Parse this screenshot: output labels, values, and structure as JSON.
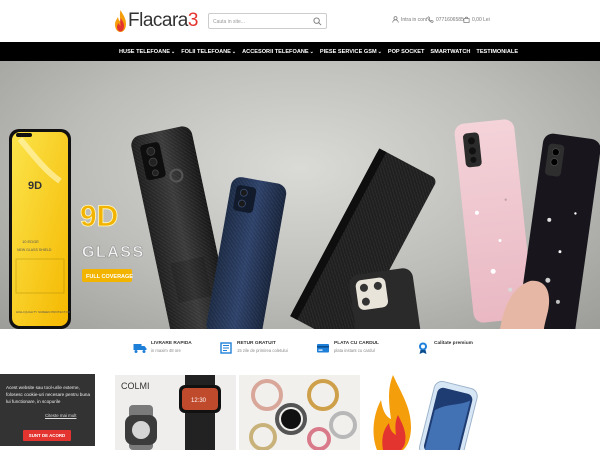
{
  "header": {
    "logo_text": "Flacara",
    "logo_number": "3",
    "search_placeholder": "Cauta in site...",
    "login_label": "Intra in cont",
    "phone": "0771606585",
    "cart_total": "0,00 Lei"
  },
  "nav": {
    "items": [
      {
        "label": "HUSE TELEFOANE",
        "dropdown": true
      },
      {
        "label": "FOLII TELEFOANE",
        "dropdown": true
      },
      {
        "label": "ACCESORII TELEFOANE",
        "dropdown": true
      },
      {
        "label": "PIESE SERVICE GSM",
        "dropdown": true
      },
      {
        "label": "POP SOCKET",
        "dropdown": false
      },
      {
        "label": "SMARTWATCH",
        "dropdown": false
      },
      {
        "label": "TESTIMONIALE",
        "dropdown": false
      }
    ]
  },
  "banner": {
    "glass_title": "9D",
    "glass_subtitle": "GLASS",
    "glass_badge": "FULL COVERAGE",
    "protector_text": "9D",
    "protector_line1": "10 EDGE",
    "protector_line2": "NEW GLASS SHIELD",
    "protector_line3": "HIGH QUALITY SCREEN PROTECTOR"
  },
  "features": [
    {
      "title": "LIVRARE RAPIDA",
      "subtitle": "in maxim 48 ore",
      "icon": "truck-icon"
    },
    {
      "title": "RETUR GRATUIT",
      "subtitle": "15 zile de primirea coletului",
      "icon": "return-box-icon"
    },
    {
      "title": "PLATA CU CARDUL",
      "subtitle": "plata instant cu cardul",
      "icon": "card-icon"
    },
    {
      "title": "Calitate premium",
      "subtitle": "",
      "icon": "medal-icon"
    }
  ],
  "tiles": {
    "watch_brand": "COLMI"
  },
  "cookie": {
    "text": "Acest website sau tool-urile externe, folosesc cookie-uri necesare pentru buna lui functionare, in scopurile",
    "link": "Citeste mai mult",
    "button": "SUNT DE ACORD"
  },
  "colors": {
    "accent": "#e3342f",
    "nav_bg": "#000000",
    "feature_icon": "#1e7fd8"
  }
}
